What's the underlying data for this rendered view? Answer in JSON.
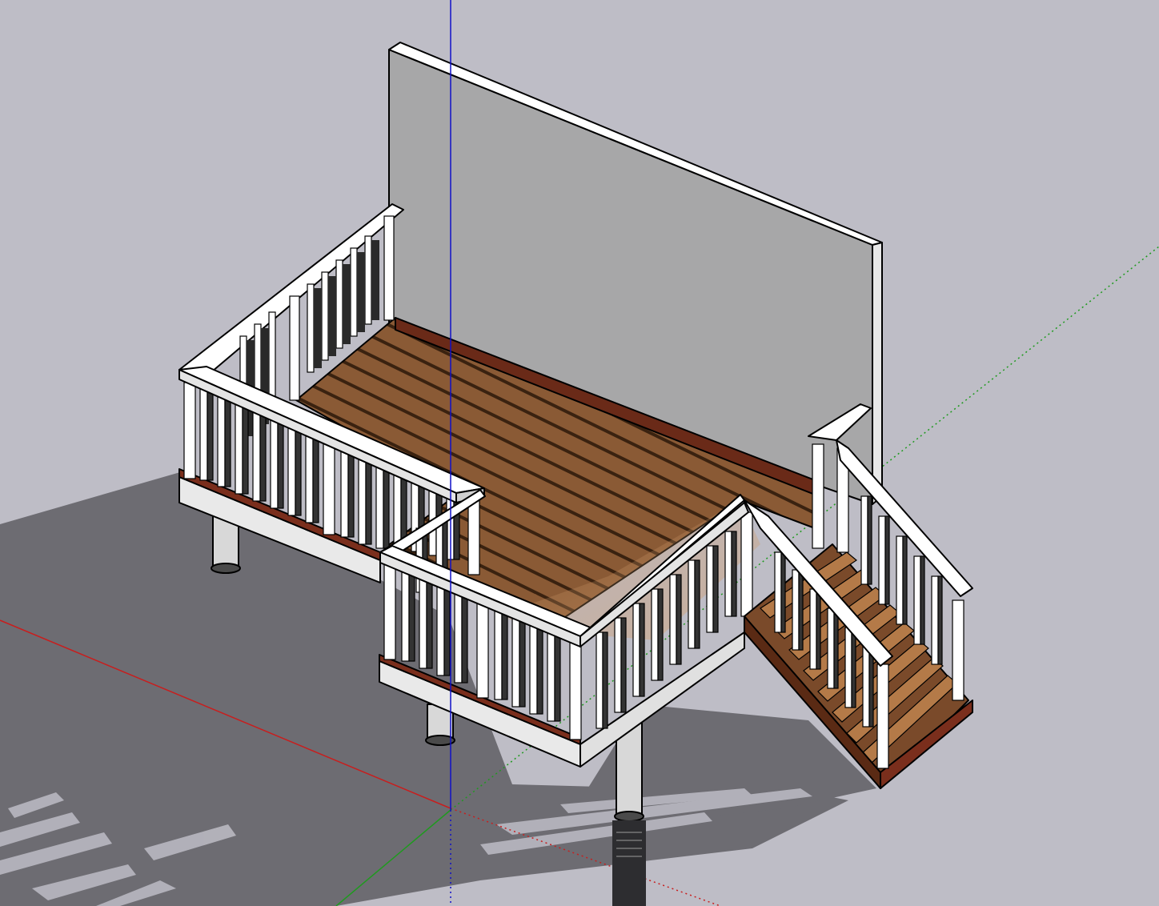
{
  "scene": {
    "name": "deck-model",
    "colors": {
      "sky": "#bebdc6",
      "ground_shadow": "#6d6c72",
      "wall": "#a7a7a8",
      "wall_light": "#d4d4d4",
      "trim_white": "#ffffff",
      "deck_wood": "#8a5a35",
      "deck_wood_light": "#b78558",
      "fascia_red": "#7a2e1c",
      "axis_red": "#c81e1e",
      "axis_green": "#1f9a1f",
      "axis_blue": "#1010c8"
    },
    "axes": [
      {
        "name": "red-axis",
        "color": "#c81e1e"
      },
      {
        "name": "green-axis",
        "color": "#1f9a1f"
      },
      {
        "name": "blue-axis",
        "color": "#1010c8"
      }
    ]
  }
}
